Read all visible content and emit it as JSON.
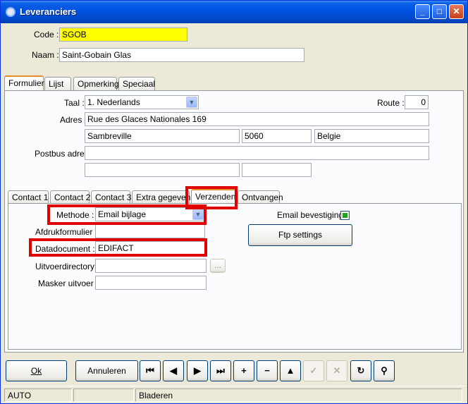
{
  "window": {
    "title": "Leveranciers"
  },
  "header": {
    "code_label": "Code :",
    "code_value": "SGOB",
    "naam_label": "Naam :",
    "naam_value": "Saint-Gobain Glas"
  },
  "main_tabs": [
    "Formulier",
    "Lijst",
    "Opmerking",
    "Speciaal"
  ],
  "formulier": {
    "taal_label": "Taal :",
    "taal_value": "1.  Nederlands",
    "route_label": "Route :",
    "route_value": "0",
    "adres_label": "Adres :",
    "adres_line1": "Rue des Glaces Nationales 169",
    "city": "Sambreville",
    "postcode": "5060",
    "country": "Belgie",
    "postbus_label": "Postbus adres:",
    "postbus_line1": "",
    "postbus_city": "",
    "postbus_postcode": ""
  },
  "sub_tabs": [
    "Contact 1",
    "Contact 2",
    "Contact 3",
    "Extra gegevens",
    "Verzenden",
    "Ontvangen"
  ],
  "verzenden": {
    "methode_label": "Methode :",
    "methode_value": "Email bijlage",
    "afdruk_label": "Afdrukformulier :",
    "afdruk_value": "",
    "datadoc_label": "Datadocument :",
    "datadoc_value": "EDIFACT",
    "uitvoer_label": "Uitvoerdirectory :",
    "uitvoer_value": "",
    "browse_label": "...",
    "masker_label": "Masker uitvoer :",
    "masker_value": "",
    "email_bevestiging_label": "Email bevestiging",
    "email_bevestiging_checked": true,
    "ftp_label": "Ftp settings"
  },
  "buttons": {
    "ok": "Ok",
    "annuleren": "Annuleren"
  },
  "status": {
    "mode": "AUTO",
    "middle": "",
    "state": "Bladeren"
  },
  "colors": {
    "code_highlight": "#ffff00",
    "annotation_red": "#e00000",
    "title_blue": "#0054e3"
  }
}
